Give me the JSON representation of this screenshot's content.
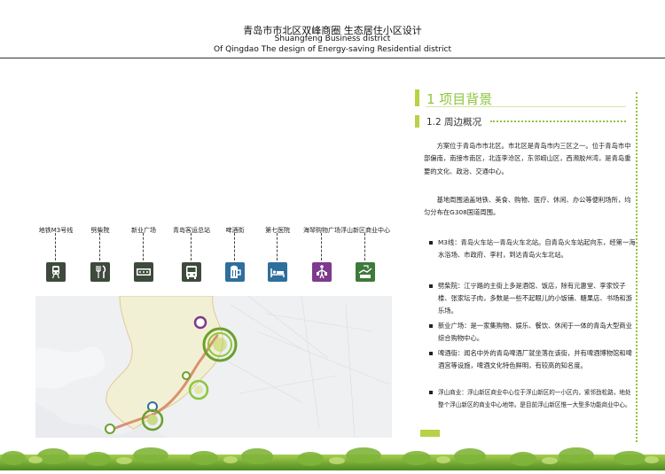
{
  "header": {
    "title_cn": "青岛市市北区双峰商圈  生态居住小区设计",
    "title_en1": "Shuangfeng Business district",
    "title_en2": "Of Qingdao The design of Energy-saving Residential district"
  },
  "section": {
    "title": "1 项目背景",
    "subtitle": "1.2 周边概况"
  },
  "paragraphs": [
    "方案位于青岛市市北区。市北区是青岛市内三区之一。位于青岛市中部偏南，南接市南区，北连李沧区，东邻崂山区，西濒胶州湾，是青岛重要的文化、政治、交通中心。",
    "基地周围涵盖地铁、美食、购物、医疗、休闲、办公等便利场所，均匀分布在G308国道周围。"
  ],
  "list": [
    "M3线：青岛火车站—青岛火车北站。自青岛火车站起向东，经第一海水浴场、市政府、李村，到达青岛火车北站。",
    "劈柴院：江宁路的主街上多是酒馆、饭店，除有元惠堂、李家饺子楼、张家坛子肉，多数是一些不起眼儿的小饭铺、糖果店、书场和游乐场。",
    "新业广场：是一家集购物、娱乐、餐饮、休闲于一体的青岛大型商业综合购物中心。",
    "啤酒街：闻名中外的青岛啤酒厂就坐落在该街，并有啤酒博物馆和啤酒宫等设施，啤酒文化特色鲜明，有较高的知名度。",
    "浮山商业：浮山新区商业中心位于浮山新区的一小区内，紧邻劲松路，地处整个浮山新区的商业中心地带。是目前浮山新区惟一大型多功能商业中心。"
  ],
  "icons": [
    {
      "label": "地铁M3号线",
      "icon": "train-icon",
      "color": "#3e4a3c"
    },
    {
      "label": "劈柴院",
      "icon": "fork-knife-icon",
      "color": "#3e4a3c"
    },
    {
      "label": "新业广场",
      "icon": "cash-register-icon",
      "color": "#3e4a3c"
    },
    {
      "label": "青岛客运总站",
      "icon": "bus-icon",
      "color": "#3e4a3c"
    },
    {
      "label": "啤酒街",
      "icon": "beer-mug-icon",
      "color": "#2e6f9b"
    },
    {
      "label": "第七医院",
      "icon": "hospital-bed-icon",
      "color": "#2e6f9b"
    },
    {
      "label": "海琴购物广场",
      "icon": "shopper-icon",
      "color": "#7e3a8c"
    },
    {
      "label": "浮山新区商业中心",
      "icon": "commerce-icon",
      "color": "#3e7a3a"
    }
  ],
  "colors": {
    "accent_green": "#8dc63f",
    "bar_green": "#b7d246",
    "map_land": "#f2f0d4",
    "map_water": "#e9ebee",
    "route": "#d9916f"
  }
}
